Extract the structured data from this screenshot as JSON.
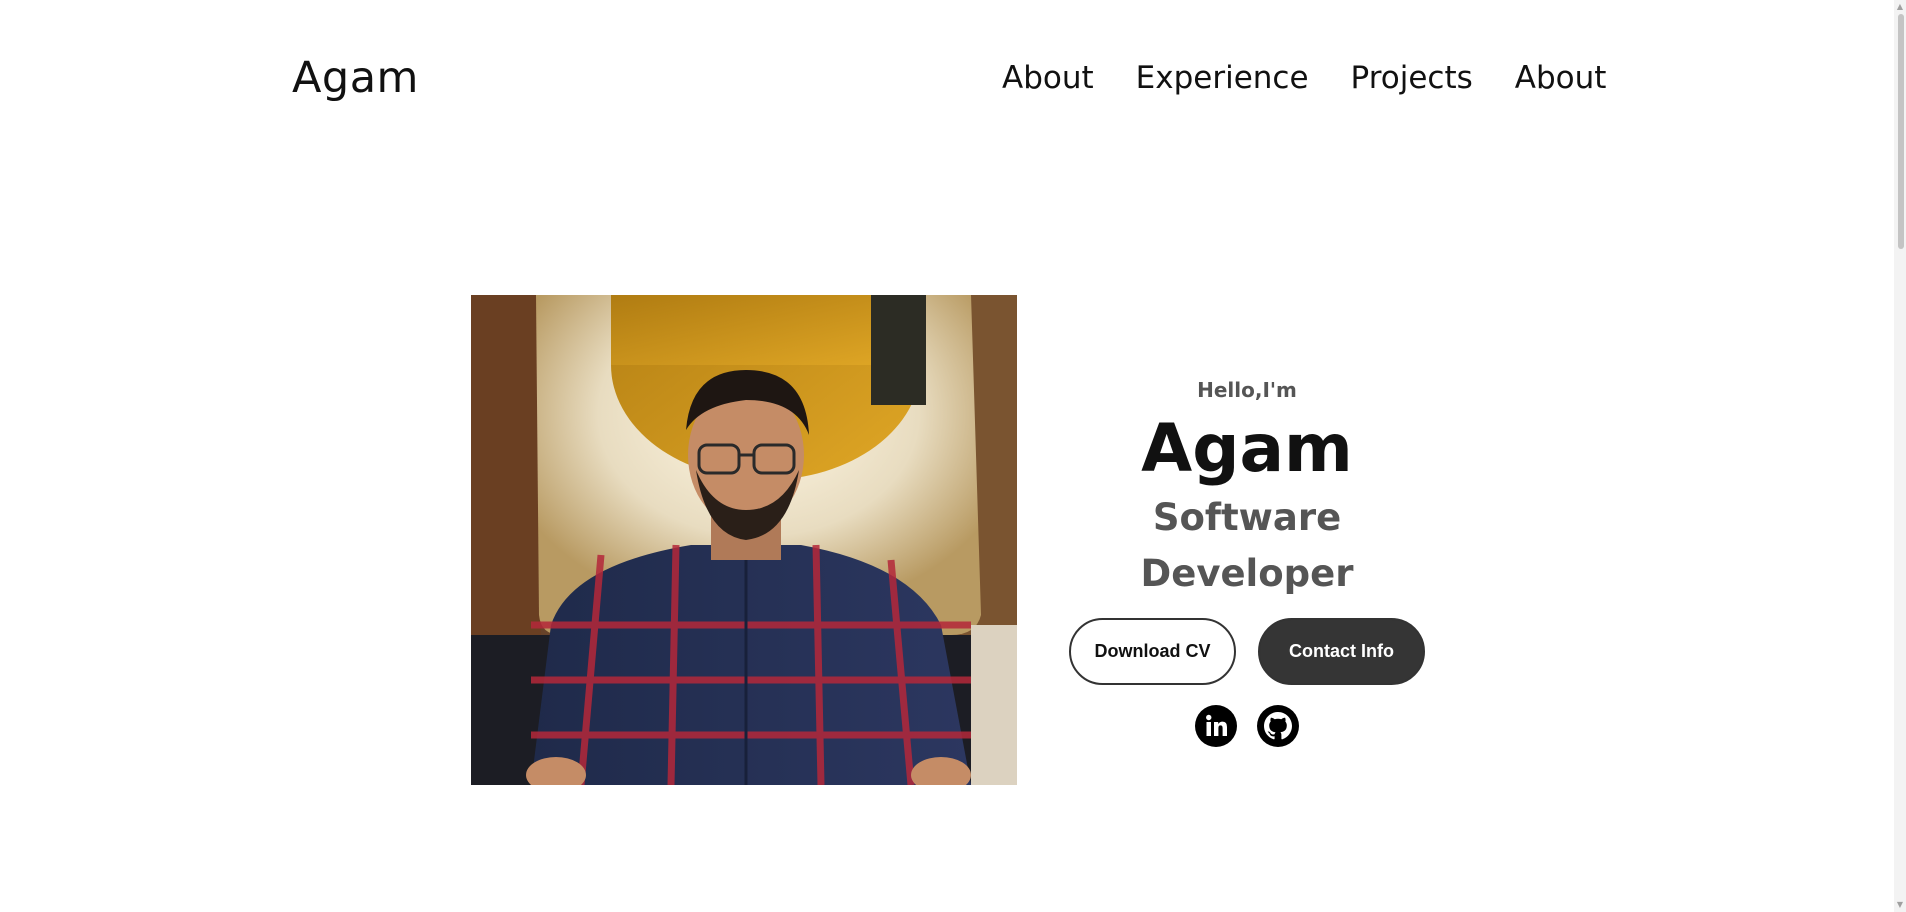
{
  "nav": {
    "logo": "Agam",
    "links": [
      "About",
      "Experience",
      "Projects",
      "About"
    ]
  },
  "hero": {
    "greeting": "Hello,I'm",
    "name": "Agam",
    "role": "Software Developer",
    "buttons": {
      "download_cv": "Download CV",
      "contact_info": "Contact Info"
    },
    "socials": [
      "linkedin-icon",
      "github-icon"
    ],
    "photo_description": "profile-photo"
  },
  "colors": {
    "text_primary": "#111111",
    "text_secondary": "#555555",
    "button_dark": "#353535",
    "background": "#ffffff"
  }
}
